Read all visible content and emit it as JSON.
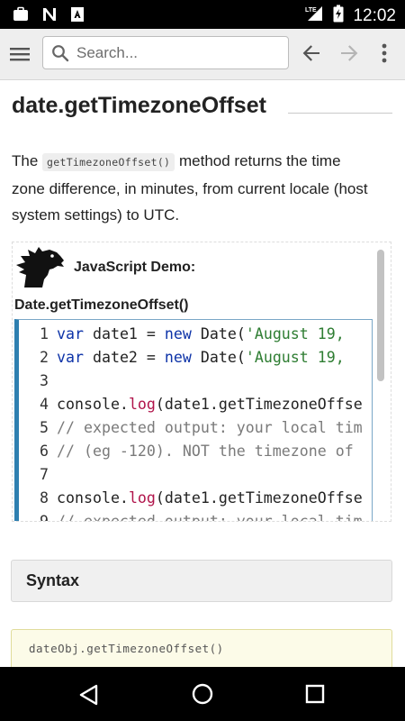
{
  "status_bar": {
    "time": "12:02",
    "network_label": "LTE",
    "icons": [
      "briefcase-icon",
      "n-app-icon",
      "a-news-icon",
      "signal-icon",
      "battery-charging-icon"
    ]
  },
  "app_bar": {
    "search_placeholder": "Search...",
    "icons": [
      "hamburger-menu-icon",
      "search-icon",
      "arrow-back-icon",
      "arrow-forward-icon",
      "more-vert-icon"
    ]
  },
  "page": {
    "title": "date.getTimezoneOffset",
    "intro": {
      "before": "The ",
      "code": "getTimezoneOffset()",
      "after": " method returns the time zone difference, in minutes, from current locale (host system settings) to UTC."
    },
    "demo": {
      "label": "JavaScript Demo:",
      "subtitle": "Date.getTimezoneOffset()",
      "code_lines": [
        {
          "n": "1",
          "text": "var date1 = new Date('August 19, "
        },
        {
          "n": "2",
          "text": "var date2 = new Date('August 19, "
        },
        {
          "n": "3",
          "text": ""
        },
        {
          "n": "4",
          "text": "console.log(date1.getTimezoneOffse"
        },
        {
          "n": "5",
          "text": "// expected output: your local tim"
        },
        {
          "n": "6",
          "text": "// (eg -120). NOT the timezone of"
        },
        {
          "n": "7",
          "text": ""
        },
        {
          "n": "8",
          "text": "console.log(date1.getTimezoneOffse"
        },
        {
          "n": "9",
          "text": "// expected output: your local tim"
        }
      ]
    },
    "syntax_heading": "Syntax",
    "syntax_code": "dateObj.getTimezoneOffset()"
  },
  "nav_bar": {
    "icons": [
      "nav-back-icon",
      "nav-home-icon",
      "nav-recents-icon"
    ]
  },
  "colors": {
    "keyword": "#0d33a8",
    "function": "#b0134a",
    "string": "#2e7d32",
    "comment": "#7a7a7a",
    "editor_accent": "#2e7fb0"
  }
}
